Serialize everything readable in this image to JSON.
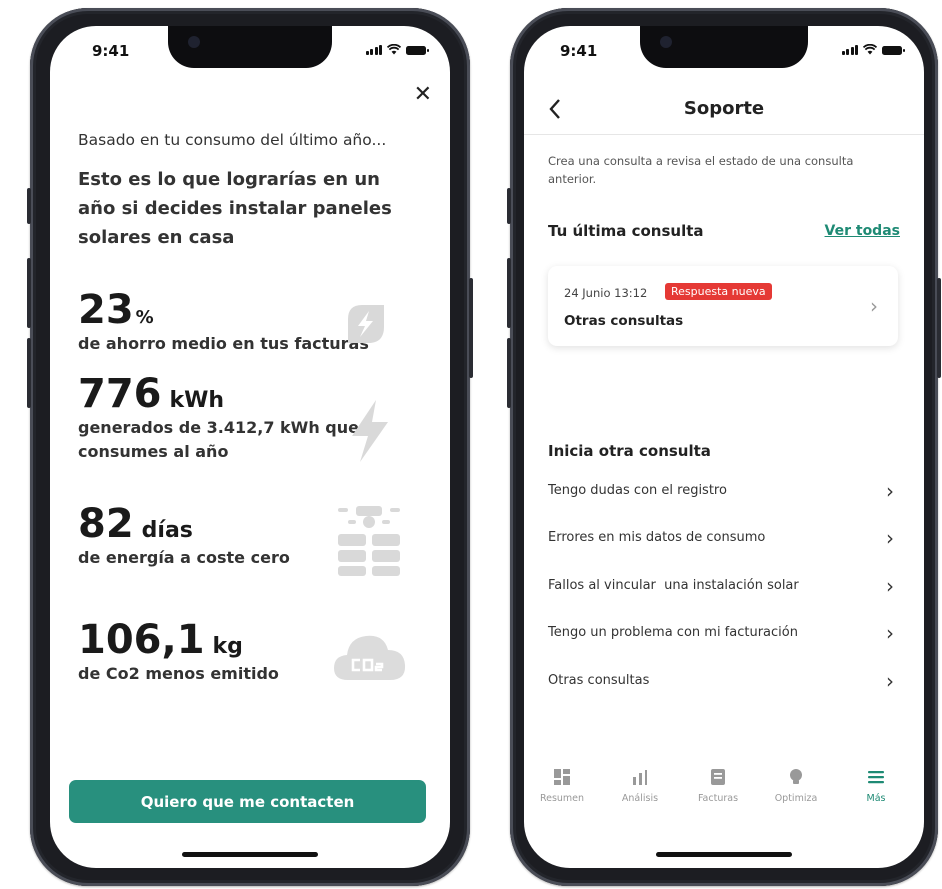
{
  "left_phone": {
    "status": {
      "time": "9:41"
    },
    "close_label": "✕",
    "intro": "Basado en tu consumo del último año...",
    "headline": "Esto es lo que lograrías en un año si decides instalar paneles solares en casa",
    "stats": [
      {
        "value": "23",
        "unit": "%",
        "description": "de ahorro medio en tus facturas",
        "icon": "leaf-bolt-icon"
      },
      {
        "value": "776",
        "unit": "kWh",
        "description": "generados de 3.412,7 kWh que consumes al año",
        "icon": "lightning-icon"
      },
      {
        "value": "82",
        "unit": "días",
        "description": "de energía a coste cero",
        "icon": "solar-panel-icon"
      },
      {
        "value": "106,1",
        "unit": "kg",
        "description": "de Co2 menos emitido",
        "icon": "co2-cloud-icon"
      }
    ],
    "cta_label": "Quiero que me contacten"
  },
  "right_phone": {
    "status": {
      "time": "9:41"
    },
    "title": "Soporte",
    "intro": "Crea una consulta a revisa el estado de una consulta anterior.",
    "last_section_title": "Tu última consulta",
    "see_all_label": "Ver todas",
    "last_query": {
      "date": "24 Junio 13:12",
      "badge": "Respuesta nueva",
      "title": "Otras consultas"
    },
    "new_section_title": "Inicia otra consulta",
    "options": [
      "Tengo dudas con el registro",
      "Errores en mis datos de consumo",
      "Fallos al vincular  una instalación solar",
      "Tengo un problema con mi facturación",
      "Otras consultas"
    ],
    "tabs": [
      {
        "label": "Resumen",
        "icon": "grid-icon",
        "active": false
      },
      {
        "label": "Análisis",
        "icon": "bar-chart-icon",
        "active": false
      },
      {
        "label": "Facturas",
        "icon": "invoice-icon",
        "active": false
      },
      {
        "label": "Optimiza",
        "icon": "bulb-icon",
        "active": false
      },
      {
        "label": "Más",
        "icon": "menu-icon",
        "active": true
      }
    ],
    "accent_color": "#1e8a74"
  },
  "colors": {
    "cta": "#28907e",
    "badge": "#e53935"
  }
}
